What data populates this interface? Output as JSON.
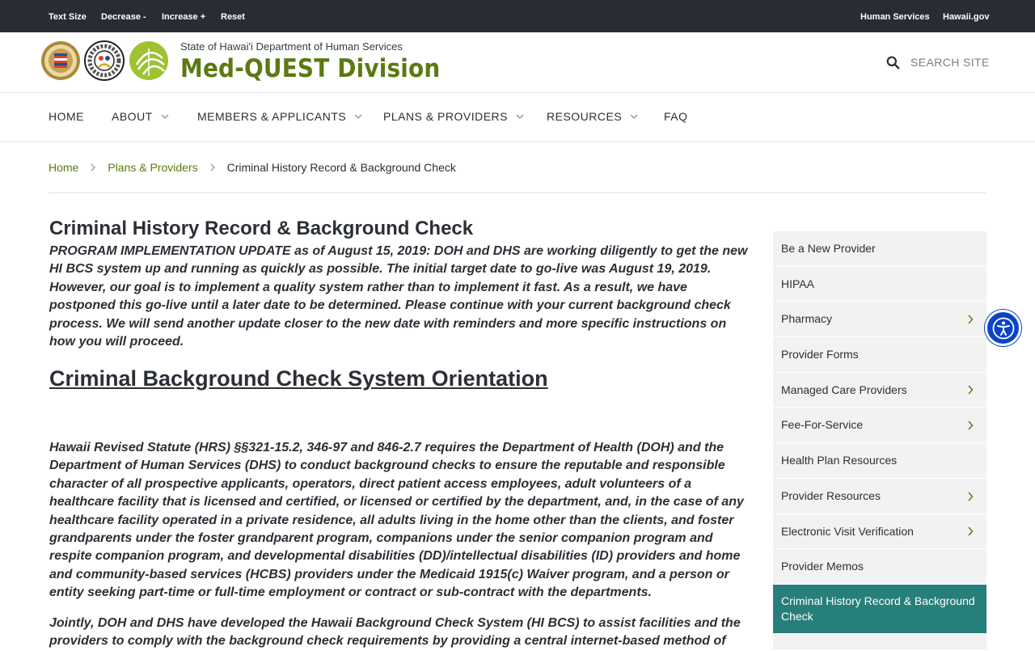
{
  "topbar": {
    "text_size": "Text Size",
    "decrease": "Decrease -",
    "increase": "Increase +",
    "reset": "Reset",
    "human_services": "Human Services",
    "hawaii_gov": "Hawaii.gov"
  },
  "header": {
    "department": "State of Hawai'i Department of Human Services",
    "division": "Med-QUEST Division",
    "search_placeholder": "SEARCH SITE"
  },
  "nav": {
    "items": [
      {
        "label": "HOME"
      },
      {
        "label": "ABOUT"
      },
      {
        "label": "MEMBERS & APPLICANTS"
      },
      {
        "label": "PLANS & PROVIDERS"
      },
      {
        "label": "RESOURCES"
      },
      {
        "label": "FAQ"
      }
    ]
  },
  "breadcrumb": {
    "home": "Home",
    "plans": "Plans & Providers",
    "current": "Criminal History Record & Background Check"
  },
  "main": {
    "title": "Criminal History Record & Background Check",
    "update": "PROGRAM IMPLEMENTATION UPDATE as of August 15, 2019:  DOH and DHS are working diligently to get the new HI BCS system up and running as quickly as possible.  The initial target date to go-live was August 19, 2019.  However, our goal is to implement a quality system rather than to implement it fast. As a result, we have postponed this go-live until a later date to be determined. Please continue with your current background check process. We will send another update closer to the new date with reminders and more specific instructions on how you will proceed.",
    "orientation_link": "Criminal Background Check System Orientation",
    "statute": "Hawaii Revised Statute (HRS) §§321-15.2, 346-97 and 846-2.7 requires the Department of Health (DOH) and the Department of Human Services (DHS) to conduct background checks to ensure the reputable and responsible character of all prospective applicants, operators, direct patient access employees, adult volunteers of a healthcare facility that is licensed and certified, or licensed or certified by the department, and, in the case of any healthcare facility operated in a private residence, all adults living in the home other than the clients, and foster grandparents under the foster grandparent program, companions under the senior companion program and respite companion program,  and developmental disabilities (DD)/intellectual disabilities (ID) providers and home and community-based services (HCBS) providers under the Medicaid 1915(c) Waiver program, and a person or entity seeking part-time or full-time employment or contract or sub-contract with the departments.",
    "jointly": "Jointly, DOH and DHS have developed the Hawaii Background Check System (HI BCS) to assist facilities and the providers to comply with the background check requirements by providing a central internet-based method of"
  },
  "sidebar": {
    "items": [
      {
        "label": "Be a New Provider",
        "has_children": false
      },
      {
        "label": "HIPAA",
        "has_children": false
      },
      {
        "label": "Pharmacy",
        "has_children": true
      },
      {
        "label": "Provider Forms",
        "has_children": false
      },
      {
        "label": "Managed Care Providers",
        "has_children": true
      },
      {
        "label": "Fee-For-Service",
        "has_children": true
      },
      {
        "label": "Health Plan Resources",
        "has_children": false
      },
      {
        "label": "Provider Resources",
        "has_children": true
      },
      {
        "label": "Electronic Visit Verification",
        "has_children": true
      },
      {
        "label": "Provider Memos",
        "has_children": false
      },
      {
        "label": "Criminal History Record & Background Check",
        "has_children": false,
        "active": true
      }
    ]
  },
  "colors": {
    "brand_green": "#5b7a12",
    "active_teal": "#267f7a",
    "topbar_bg": "#282d33",
    "a11y_blue": "#0b44c6"
  }
}
